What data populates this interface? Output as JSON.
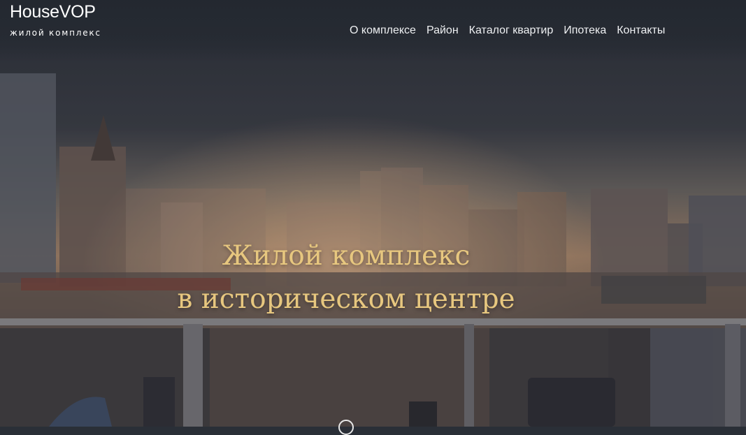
{
  "brand": {
    "name": "HouseVOP",
    "subtitle": "жилой комплекс"
  },
  "nav": [
    {
      "label": "О комплексе"
    },
    {
      "label": "Район"
    },
    {
      "label": "Каталог квартир"
    },
    {
      "label": "Ипотека"
    },
    {
      "label": "Контакты"
    }
  ],
  "hero": {
    "title_line1": "Жилой комплекс",
    "title_line2": "в историческом центре"
  },
  "colors": {
    "headline": "#e7c77f",
    "sky_top": "#2a2f37",
    "sky_glow": "#c7a179"
  },
  "icons": {
    "scroll": "scroll-down-icon"
  }
}
